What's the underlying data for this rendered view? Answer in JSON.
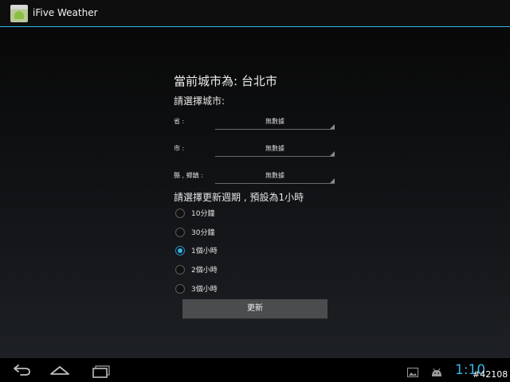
{
  "app": {
    "title": "iFive Weather"
  },
  "main": {
    "current_city_text": "當前城市為: 台北市",
    "select_city_label": "請選擇城市:",
    "fields": [
      {
        "label": "省 :",
        "value": "無數據"
      },
      {
        "label": "市 :",
        "value": "無數據"
      },
      {
        "label": "縣 , 鄉鎮 :",
        "value": "無數據"
      }
    ],
    "period_label": "請選擇更新週期 , 預設為1小時",
    "periods": [
      {
        "label": "10分鐘",
        "checked": false
      },
      {
        "label": "30分鐘",
        "checked": false
      },
      {
        "label": "1個小時",
        "checked": true
      },
      {
        "label": "2個小時",
        "checked": false
      },
      {
        "label": "3個小時",
        "checked": false
      }
    ],
    "update_button_label": "更新"
  },
  "status_bar": {
    "time": "1:10"
  },
  "watermark": "#42108",
  "icons": {
    "back": "back-arrow-icon",
    "home": "home-icon",
    "recents": "recent-apps-icon",
    "gallery": "gallery-icon",
    "android": "android-debug-icon"
  },
  "colors": {
    "accent": "#33b5e5"
  }
}
